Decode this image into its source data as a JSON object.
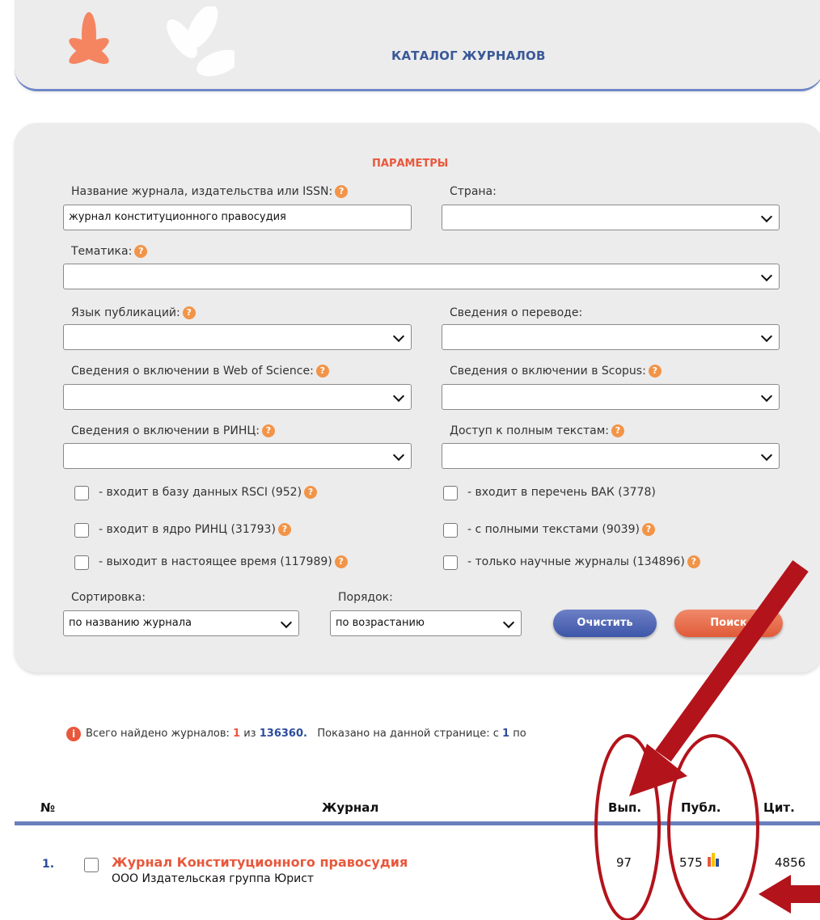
{
  "header": {
    "title": "КАТАЛОГ ЖУРНАЛОВ"
  },
  "params": {
    "title": "ПАРАМЕТРЫ",
    "help_glyph": "?",
    "journal_name": {
      "label": "Название журнала, издательства или ISSN:",
      "value": "журнал конституционного правосудия"
    },
    "country": {
      "label": "Страна:",
      "value": ""
    },
    "topic": {
      "label": "Тематика:",
      "value": ""
    },
    "language": {
      "label": "Язык публикаций:",
      "value": ""
    },
    "translation": {
      "label": "Сведения о переводе:",
      "value": ""
    },
    "wos": {
      "label": "Сведения о включении в Web of Science:",
      "value": ""
    },
    "scopus": {
      "label": "Сведения о включении в Scopus:",
      "value": ""
    },
    "rinc": {
      "label": "Сведения о включении в РИНЦ:",
      "value": ""
    },
    "fulltext_access": {
      "label": "Доступ к полным текстам:",
      "value": ""
    },
    "checkboxes": [
      {
        "label": "- входит в базу данных RSCI (952)",
        "checked": false
      },
      {
        "label": "- входит в перечень ВАК (3778)",
        "checked": false
      },
      {
        "label": "- входит в ядро РИНЦ (31793)",
        "checked": false
      },
      {
        "label": "- с полными текстами (9039)",
        "checked": false
      },
      {
        "label": "- выходит в настоящее время (117989)",
        "checked": false
      },
      {
        "label": "- только научные журналы (134896)",
        "checked": false
      }
    ],
    "sort": {
      "label": "Сортировка:",
      "value": "по названию журнала"
    },
    "order": {
      "label": "Порядок:",
      "value": "по возрастанию"
    },
    "clear_label": "Очистить",
    "search_label": "Поиск"
  },
  "results": {
    "info_glyph": "i",
    "summary_prefix": "Всего найдено журналов:",
    "found": "1",
    "of_word": "из",
    "total": "136360.",
    "shown_prefix": "Показано на данной странице: с",
    "shown_from": "1",
    "shown_suffix": "по",
    "columns": {
      "num": "№",
      "journal": "Журнал",
      "issues": "Вып.",
      "pubs": "Публ.",
      "cites": "Цит."
    },
    "rows": [
      {
        "num": "1.",
        "title": "Журнал Конституционного правосудия",
        "publisher": "ООО Издательская группа Юрист",
        "issues": "97",
        "pubs": "575",
        "cites": "4856"
      }
    ]
  },
  "colors": {
    "accent": "#e8583c",
    "primary": "#3e56a8",
    "annotation": "#b3131b"
  }
}
